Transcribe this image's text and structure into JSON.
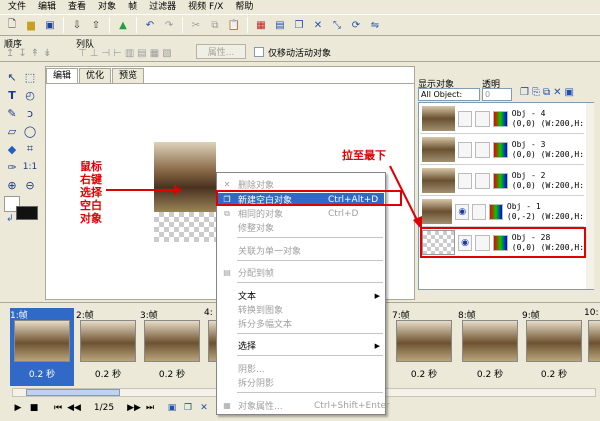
{
  "menubar": [
    "文件",
    "编辑",
    "查看",
    "对象",
    "帧",
    "过滤器",
    "视频 F/X",
    "帮助"
  ],
  "toolbar2": {
    "order_label": "顺序",
    "column_label": "列队",
    "properties_button": "属性...",
    "move_active_only": "仅移动活动对象"
  },
  "tabs": [
    "编辑",
    "优化",
    "预览"
  ],
  "right_panel": {
    "display_objects_label": "显示对象",
    "transparency_label": "透明",
    "filter_value": "All Object:",
    "transparency_value": "0",
    "layers": [
      {
        "name": "Obj - 4",
        "info": "(0,0) (W:200,H:"
      },
      {
        "name": "Obj - 3",
        "info": "(0,0) (W:200,H:"
      },
      {
        "name": "Obj - 2",
        "info": "(0,0) (W:200,H:"
      },
      {
        "name": "Obj - 1",
        "info": "(0,-2) (W:200,H:"
      },
      {
        "name": "Obj - 28",
        "info": "(0,0) (W:200,H:"
      }
    ]
  },
  "annotations": {
    "left_note": "鼠标\n右键\n选择\n空白\n对象",
    "right_note": "拉至最下"
  },
  "context_menu": {
    "items": [
      {
        "label": "删除对象",
        "shortcut": "",
        "disabled": true,
        "highlight": false,
        "submenu": false
      },
      {
        "label": "新建空白对象",
        "shortcut": "Ctrl+Alt+D",
        "disabled": false,
        "highlight": true,
        "submenu": false
      },
      {
        "label": "相同的对象",
        "shortcut": "Ctrl+D",
        "disabled": true,
        "highlight": false,
        "submenu": false
      },
      {
        "label": "修整对象",
        "shortcut": "",
        "disabled": true,
        "highlight": false,
        "submenu": false
      },
      {
        "label": "关联为单一对象",
        "shortcut": "",
        "disabled": true,
        "highlight": false,
        "submenu": false
      },
      {
        "label": "分配到帧",
        "shortcut": "",
        "disabled": true,
        "highlight": false,
        "submenu": false
      },
      {
        "label": "文本",
        "shortcut": "",
        "disabled": false,
        "highlight": false,
        "submenu": true
      },
      {
        "label": "转换到图象",
        "shortcut": "",
        "disabled": true,
        "highlight": false,
        "submenu": false
      },
      {
        "label": "拆分多幅文本",
        "shortcut": "",
        "disabled": true,
        "highlight": false,
        "submenu": false
      },
      {
        "label": "选择",
        "shortcut": "",
        "disabled": false,
        "highlight": false,
        "submenu": true
      },
      {
        "label": "阴影...",
        "shortcut": "",
        "disabled": true,
        "highlight": false,
        "submenu": false
      },
      {
        "label": "拆分阴影",
        "shortcut": "",
        "disabled": true,
        "highlight": false,
        "submenu": false
      },
      {
        "label": "对象属性...",
        "shortcut": "Ctrl+Shift+Enter",
        "disabled": true,
        "highlight": false,
        "submenu": false
      }
    ]
  },
  "frames": [
    {
      "label": "1:帧",
      "duration": "0.2 秒"
    },
    {
      "label": "2:帧",
      "duration": "0.2 秒"
    },
    {
      "label": "3:帧",
      "duration": "0.2 秒"
    },
    {
      "label": "4:",
      "duration": ""
    },
    {
      "label": "7:帧",
      "duration": "0.2 秒"
    },
    {
      "label": "8:帧",
      "duration": "0.2 秒"
    },
    {
      "label": "9:帧",
      "duration": "0.2 秒"
    },
    {
      "label": "10:",
      "duration": ""
    }
  ],
  "playbar": {
    "frame_counter": "1/25"
  }
}
